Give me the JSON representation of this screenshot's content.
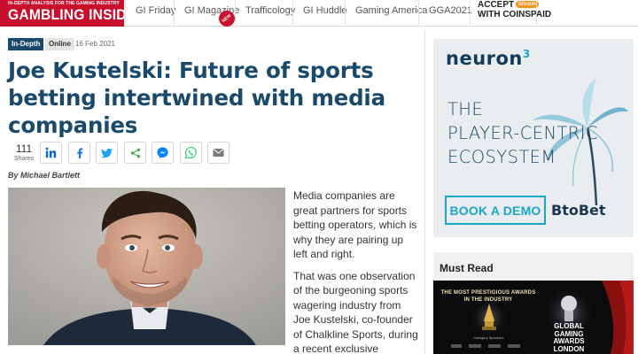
{
  "header": {
    "logo_tagline": "IN-DEPTH ANALYSIS FOR THE GAMING INDUSTRY",
    "logo_name": "GAMBLING INSIDER",
    "nav": [
      "GI Friday",
      "GI Magazine",
      "Trafficology",
      "GI Huddle",
      "Gaming America",
      "GGA2021"
    ],
    "new_badge": "NEW",
    "top_ad": {
      "line1": "ACCEPT",
      "badge": "bitcoin",
      "line2": "WITH COINSPAID"
    }
  },
  "article": {
    "tag": "In-Depth",
    "category": "Online",
    "date": "16 Feb 2021",
    "headline": "Joe Kustelski: Future of sports betting intertwined with media companies",
    "share_count": "111",
    "share_label": "Shares",
    "share_buttons": [
      "linkedin",
      "facebook",
      "twitter",
      "share",
      "messenger",
      "whatsapp",
      "email"
    ],
    "byline": "By Michael Bartlett",
    "paragraphs": [
      "Media companies are great partners for sports betting operators, which is why they are pairing up left and right.",
      "That was one observation of the burgeoning sports wagering industry from Joe Kustelski, co-founder of Chalkline Sports, during a recent exclusive"
    ]
  },
  "sidebar": {
    "ad": {
      "brand": "neuron",
      "brand_sup": "3",
      "lines": [
        "THE",
        "PLAYER-CENTRIC",
        "ECOSYSTEM"
      ],
      "cta": "BOOK A DEMO",
      "vendor": "BtoBet"
    },
    "must_read": {
      "heading": "Must Read",
      "card_title": "THE MOST PRESTIGIOUS AWARDS IN THE INDUSTRY",
      "card_sponsors": "Category Sponsors",
      "card_award": "GLOBAL GAMING AWARDS LONDON"
    }
  },
  "colors": {
    "brand_red": "#c8102e",
    "headline_blue": "#1a4a6b",
    "ad_cyan": "#1aa6c9"
  }
}
